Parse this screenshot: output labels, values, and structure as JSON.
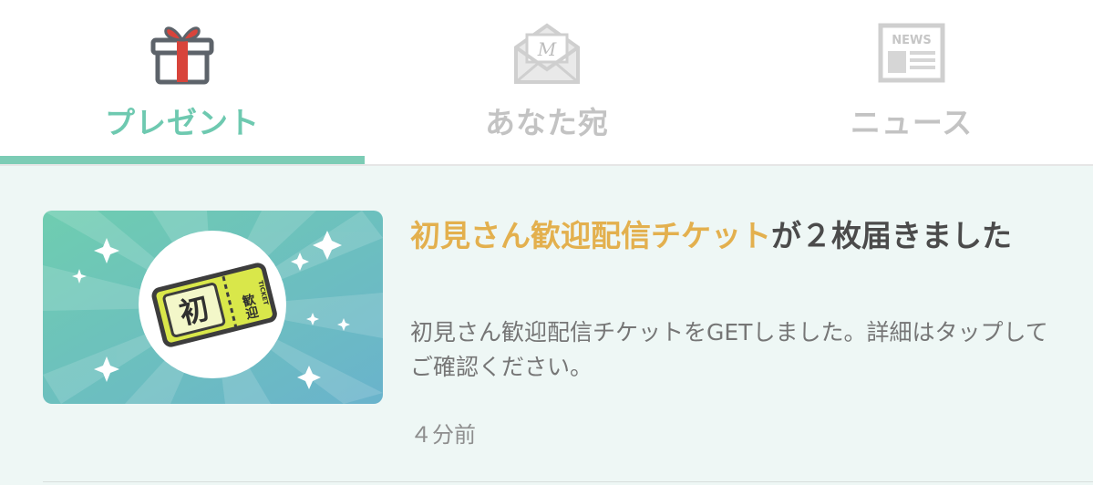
{
  "tabs": [
    {
      "label": "プレゼント",
      "icon": "gift-icon",
      "active": true
    },
    {
      "label": "あなた宛",
      "icon": "mail-icon",
      "active": false
    },
    {
      "label": "ニュース",
      "icon": "news-icon",
      "active": false
    }
  ],
  "icons": {
    "mail_letter": "M",
    "news_word": "NEWS"
  },
  "notification": {
    "title_highlight": "初見さん歓迎配信チケット",
    "title_rest": "が２枚届きました",
    "body": "初見さん歓迎配信チケットをGETしました。詳細はタップしてご確認ください。",
    "time": "４分前",
    "ticket": {
      "main_char": "初",
      "sub_chars": "歓迎",
      "side_text": "TICKET"
    }
  },
  "colors": {
    "accent": "#7cccb5",
    "tab_active": "#6ec9b0",
    "tab_inactive": "#c3c3c3",
    "highlight": "#e3b04e",
    "content_bg": "#eef7f5",
    "gift_red": "#d8443b",
    "gift_outline": "#5d636a"
  }
}
